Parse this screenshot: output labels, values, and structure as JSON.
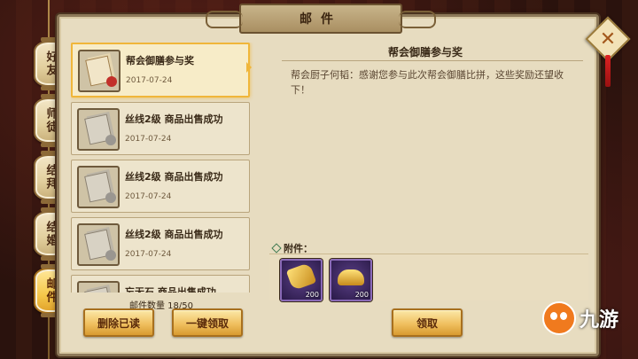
{
  "window": {
    "title": "邮件"
  },
  "tabs": [
    {
      "label": "好友",
      "active": false
    },
    {
      "label": "师徒",
      "active": false
    },
    {
      "label": "结拜",
      "active": false
    },
    {
      "label": "结婚",
      "active": false
    },
    {
      "label": "邮件",
      "active": true
    }
  ],
  "mails": [
    {
      "subject": "帮会御膳参与奖",
      "date": "2017-07-24",
      "selected": true
    },
    {
      "subject": "丝线2级 商品出售成功",
      "date": "2017-07-24",
      "selected": false
    },
    {
      "subject": "丝线2级 商品出售成功",
      "date": "2017-07-24",
      "selected": false
    },
    {
      "subject": "丝线2级 商品出售成功",
      "date": "2017-07-24",
      "selected": false
    },
    {
      "subject": "忘无石 商品出售成功",
      "date": "",
      "selected": false
    }
  ],
  "mail_count": "邮件数量 18/50",
  "buttons": {
    "delete_read": "删除已读",
    "claim_all": "一键领取",
    "claim": "领取"
  },
  "detail": {
    "title": "帮会御膳参与奖",
    "body": "帮会厨子何韬：感谢您参与此次帮会御膳比拼，这些奖励还望收下！",
    "attachment_label": "附件：",
    "attachments": [
      {
        "icon": "gold-token-icon",
        "quantity": "200"
      },
      {
        "icon": "gold-ingot-icon",
        "quantity": "200"
      }
    ]
  },
  "watermark": {
    "text": "九游"
  },
  "colors": {
    "accent": "#f0b63a",
    "panel": "#e7dcc0",
    "button": "#f0c060",
    "item_frame": "#8a6ab8"
  }
}
